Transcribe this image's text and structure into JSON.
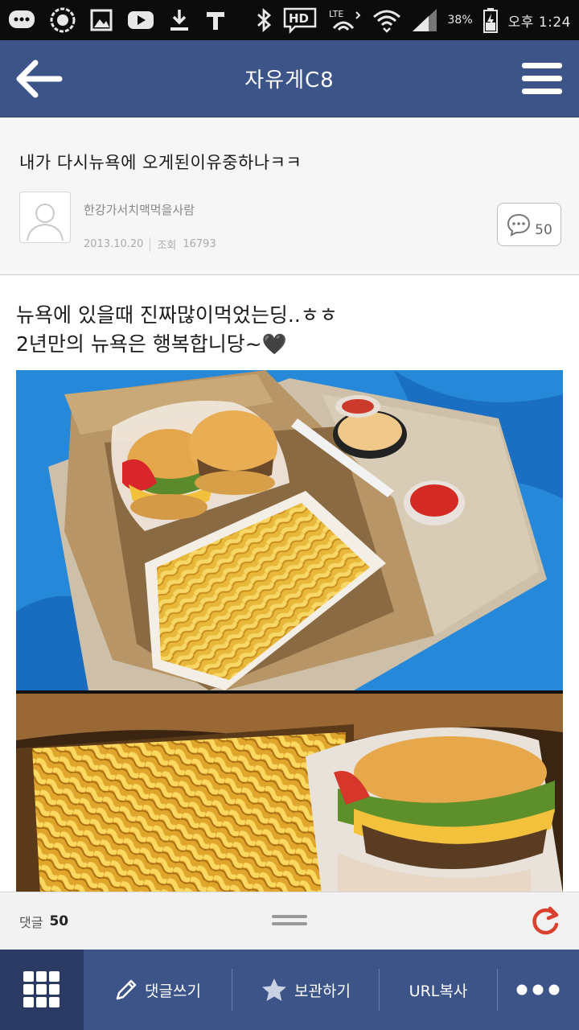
{
  "status_bar": {
    "icons_left": [
      "chat-bubble-icon",
      "camera-icon",
      "gallery-icon",
      "youtube-icon",
      "download-icon",
      "t-icon"
    ],
    "icons_right": [
      "bluetooth-icon",
      "hd-icon",
      "lte-icon",
      "wifi-icon",
      "signal-icon",
      "battery-icon"
    ],
    "battery": "38%",
    "time": "오후 1:24"
  },
  "header": {
    "title": "자유게C8",
    "back_icon": "back-arrow-icon",
    "menu_icon": "hamburger-menu-icon"
  },
  "post": {
    "title": "내가 다시뉴욕에 오게된이유중하나ㅋㅋ",
    "author": "한강가서치맥먹을사람",
    "date": "2013.10.20",
    "views_label": "조회",
    "views": "16793",
    "comment_count": "50",
    "body_lines": [
      "뉴욕에 있을때 진짜많이먹었는딩..ㅎㅎ",
      "2년만의 뉴욕은 행복합니당~🖤"
    ]
  },
  "comment_bar": {
    "label": "댓글",
    "count": "50"
  },
  "bottom_nav": {
    "write_comment": "댓글쓰기",
    "bookmark": "보관하기",
    "copy_url": "URL복사"
  },
  "colors": {
    "header_bg": "#3c5488",
    "grid_bg": "#2b3b63",
    "refresh_red": "#d9412e"
  }
}
